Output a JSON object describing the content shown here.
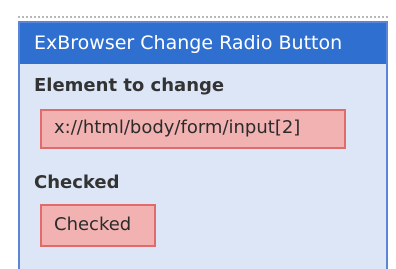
{
  "panel": {
    "title": "ExBrowser Change Radio Button",
    "fields": [
      {
        "label": "Element to change",
        "value": "x://html/body/form/input[2]"
      },
      {
        "label": "Checked",
        "value": "Checked"
      }
    ]
  },
  "colors": {
    "header_bg": "#2f6fd0",
    "panel_bg": "#dde6f7",
    "panel_border": "#5b86d8",
    "value_bg": "#f2b2b2",
    "value_border": "#e06b6b"
  }
}
